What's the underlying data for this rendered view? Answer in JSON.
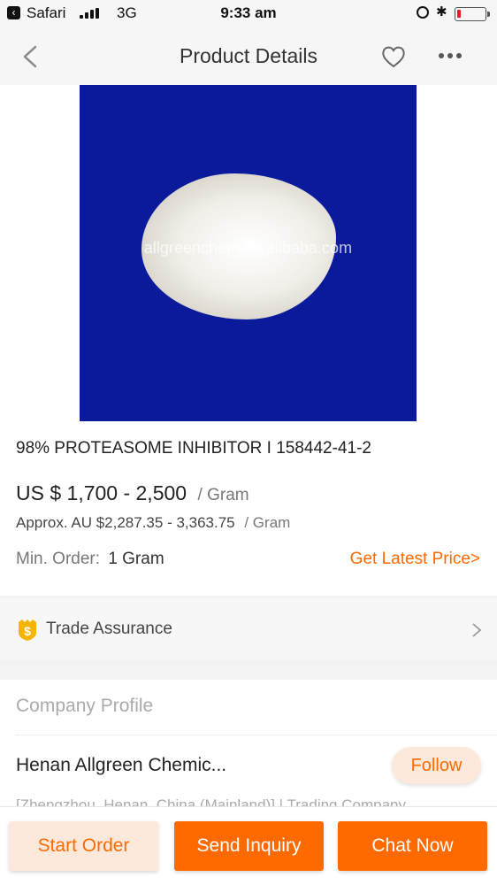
{
  "status_bar": {
    "carrier": "Safari",
    "network": "3G",
    "time": "9:33 am"
  },
  "nav": {
    "title": "Product Details"
  },
  "product": {
    "image_watermark": "allgreenchem.en.alibaba.com",
    "title": "98% PROTEASOME INHIBITOR I 158442-41-2",
    "price": "US $ 1,700 - 2,500",
    "price_unit": "/ Gram",
    "approx_price": "Approx. AU $2,287.35 - 3,363.75",
    "approx_unit": "/ Gram",
    "min_order_label": "Min. Order:",
    "min_order_value": "1 Gram",
    "latest_price_link": "Get Latest Price>"
  },
  "trade_assurance": {
    "label": "Trade Assurance"
  },
  "company": {
    "section_title": "Company Profile",
    "name": "Henan Allgreen Chemic...",
    "follow_label": "Follow",
    "location": "[Zhengzhou, Henan, China (Mainland)] | Trading Company"
  },
  "actions": {
    "start_order": "Start Order",
    "send_inquiry": "Send Inquiry",
    "chat_now": "Chat Now"
  },
  "colors": {
    "accent": "#ff6a00",
    "image_background": "#0a1a9a"
  }
}
